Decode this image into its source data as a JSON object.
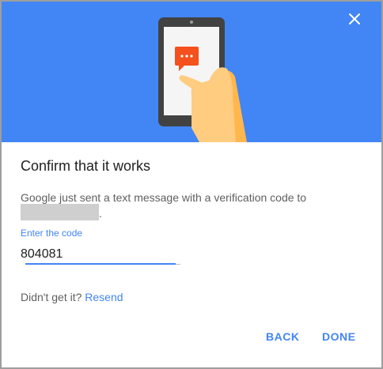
{
  "dialog": {
    "title": "Confirm that it works",
    "description": "Google just sent a text message with a verification code to",
    "redacted_trailing": ".",
    "code_label": "Enter the code",
    "code_value": "804081",
    "resend_prefix": "Didn't get it?",
    "resend_link": "Resend",
    "back_label": "BACK",
    "done_label": "DONE"
  },
  "colors": {
    "banner": "#4285f4",
    "accent": "#4285f4",
    "bubble": "#f4511e",
    "hand": "#ffcc80"
  },
  "icons": {
    "close": "close-icon",
    "illustration": "phone-message-illustration"
  }
}
